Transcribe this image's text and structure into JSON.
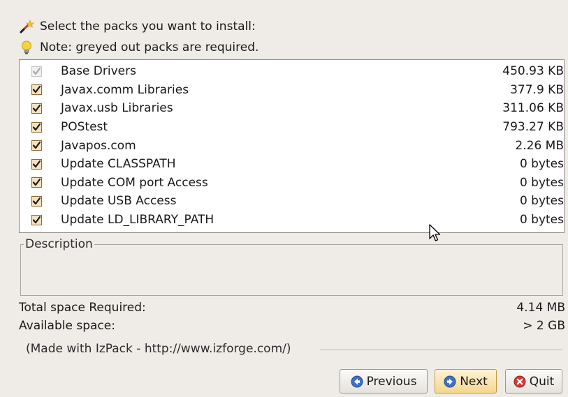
{
  "header": {
    "select_text": "Select the packs you want to install:",
    "note_text": "Note: greyed out packs are required.",
    "select_icon": "magic-wand-icon",
    "note_icon": "lightbulb-icon"
  },
  "packs": [
    {
      "name": "Base Drivers",
      "size": "450.93 KB",
      "checked": true,
      "required": true
    },
    {
      "name": "Javax.comm Libraries",
      "size": "377.9 KB",
      "checked": true,
      "required": false
    },
    {
      "name": "Javax.usb Libraries",
      "size": "311.06 KB",
      "checked": true,
      "required": false
    },
    {
      "name": "POStest",
      "size": "793.27 KB",
      "checked": true,
      "required": false
    },
    {
      "name": "Javapos.com",
      "size": "2.26 MB",
      "checked": true,
      "required": false
    },
    {
      "name": "Update CLASSPATH",
      "size": "0 bytes",
      "checked": true,
      "required": false
    },
    {
      "name": "Update COM port Access",
      "size": "0 bytes",
      "checked": true,
      "required": false
    },
    {
      "name": "Update USB Access",
      "size": "0 bytes",
      "checked": true,
      "required": false
    },
    {
      "name": "Update LD_LIBRARY_PATH",
      "size": "0 bytes",
      "checked": true,
      "required": false
    }
  ],
  "description": {
    "legend": "Description",
    "text": ""
  },
  "space": {
    "total_label": "Total space Required:",
    "total_value": "4.14 MB",
    "available_label": "Available space:",
    "available_value": "> 2 GB"
  },
  "credit": "(Made with IzPack - http://www.izforge.com/)",
  "buttons": {
    "previous": "Previous",
    "next": "Next",
    "quit": "Quit"
  },
  "colors": {
    "background": "#efebe7",
    "checkbox_fill": "#f6e1bf",
    "checkmark": "#1a1a1a",
    "next_highlight": "#f4d68f",
    "arrow_icon_blue": "#3b73c4",
    "quit_icon_red": "#d33b3b"
  }
}
